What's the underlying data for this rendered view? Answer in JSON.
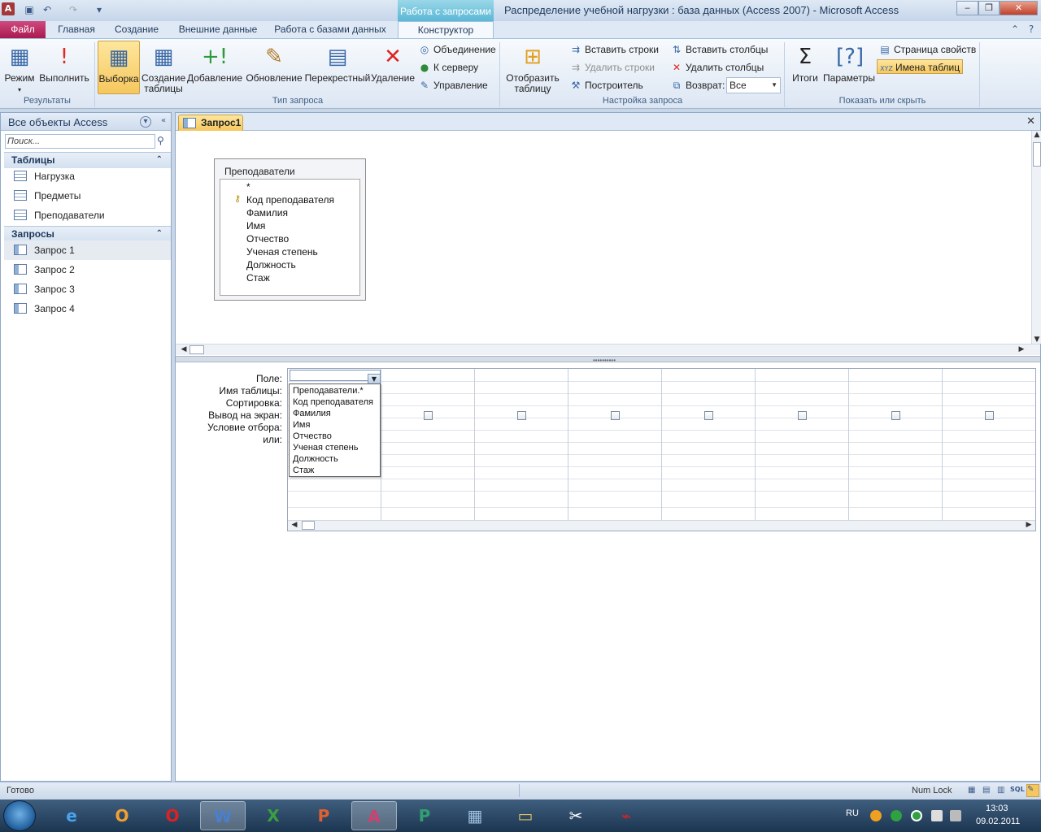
{
  "window": {
    "title": "Распределение учебной нагрузки : база данных (Access 2007)  -  Microsoft Access",
    "context_tab": "Работа с запросами",
    "app_icon": "A"
  },
  "qat": {
    "save": "save-icon",
    "undo": "undo-icon",
    "redo": "redo-icon"
  },
  "tabs": {
    "file": "Файл",
    "items": [
      "Главная",
      "Создание",
      "Внешние данные",
      "Работа с базами данных"
    ],
    "active": "Конструктор"
  },
  "ribbon": {
    "results": {
      "label": "Результаты",
      "mode": "Режим",
      "run": "Выполнить"
    },
    "query_type": {
      "label": "Тип запроса",
      "select": "Выборка",
      "make_table": "Создание таблицы",
      "append": "Добавление",
      "update": "Обновление",
      "crosstab": "Перекрестный",
      "delete": "Удаление",
      "union": "Объединение",
      "pass_through": "К серверу",
      "data_def": "Управление"
    },
    "setup": {
      "label": "Настройка запроса",
      "show_table": "Отобразить таблицу",
      "insert_rows": "Вставить строки",
      "delete_rows": "Удалить строки",
      "builder": "Построитель",
      "insert_cols": "Вставить столбцы",
      "delete_cols": "Удалить столбцы",
      "return_label": "Возврат:",
      "return_value": "Все"
    },
    "show_hide": {
      "label": "Показать или скрыть",
      "totals": "Итоги",
      "params": "Параметры",
      "property_sheet": "Страница свойств",
      "table_names": "Имена таблиц"
    }
  },
  "nav": {
    "title": "Все объекты Access",
    "search_placeholder": "Поиск...",
    "sections": [
      {
        "title": "Таблицы",
        "items": [
          "Нагрузка",
          "Предметы",
          "Преподаватели"
        ]
      },
      {
        "title": "Запросы",
        "items": [
          "Запрос 1",
          "Запрос 2",
          "Запрос 3",
          "Запрос 4"
        ]
      }
    ]
  },
  "doc": {
    "tab": "Запрос1"
  },
  "table_box": {
    "title": "Преподаватели",
    "fields": [
      "*",
      "Код преподавателя",
      "Фамилия",
      "Имя",
      "Отчество",
      "Ученая степень",
      "Должность",
      "Стаж"
    ]
  },
  "grid": {
    "labels": [
      "Поле:",
      "Имя таблицы:",
      "Сортировка:",
      "Вывод на экран:",
      "Условие отбора:",
      "или:"
    ]
  },
  "dropdown": {
    "options": [
      "Преподаватели.*",
      "Код преподавателя",
      "Фамилия",
      "Имя",
      "Отчество",
      "Ученая степень",
      "Должность",
      "Стаж"
    ]
  },
  "status": {
    "text": "Готово",
    "numlock": "Num Lock"
  },
  "taskbar": {
    "lang": "RU",
    "time": "13:03",
    "date": "09.02.2011"
  }
}
